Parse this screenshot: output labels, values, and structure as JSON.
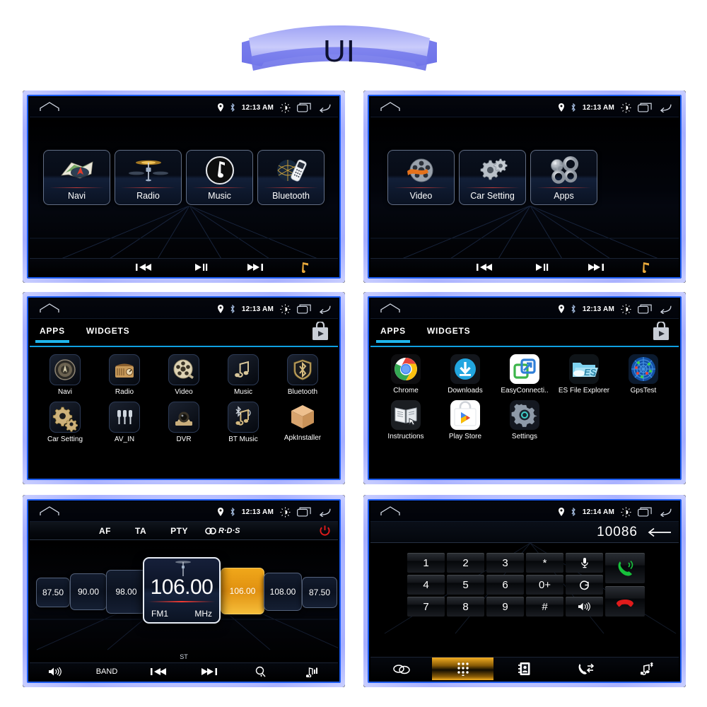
{
  "banner": {
    "title": "UI",
    "color": "#7b7ef0"
  },
  "theme": {
    "accent_blue": "#1b5cf0",
    "tab_underline": "#1fb6ec",
    "highlight_orange": "#f0a71a",
    "call_green": "#17c13b",
    "hangup_red": "#e01b1b"
  },
  "status_bar": {
    "home_icon": "home-icon",
    "location_icon": "location-pin-icon",
    "bluetooth_icon": "bluetooth-icon",
    "time": "12:13 AM",
    "brightness_icon": "brightness-icon",
    "recents_icon": "recents-icon",
    "back_icon": "back-arrow-icon"
  },
  "status_bar_dialer": {
    "time": "12:14 AM"
  },
  "panels": [
    {
      "name": "home-page-1",
      "tiles": [
        {
          "label": "Navi",
          "icon": "map-icon"
        },
        {
          "label": "Radio",
          "icon": "radio-antenna-icon"
        },
        {
          "label": "Music",
          "icon": "music-note-icon"
        },
        {
          "label": "Bluetooth",
          "icon": "bluetooth-phone-icon"
        }
      ],
      "media_bar": [
        "prev-track-icon",
        "play-pause-icon",
        "next-track-icon",
        "music-note-icon"
      ]
    },
    {
      "name": "home-page-2",
      "tiles": [
        {
          "label": "Video",
          "icon": "film-reel-icon"
        },
        {
          "label": "Car Setting",
          "icon": "gears-icon"
        },
        {
          "label": "Apps",
          "icon": "apps-circles-icon"
        }
      ],
      "media_bar": [
        "prev-track-icon",
        "play-pause-icon",
        "next-track-icon",
        "music-note-icon"
      ]
    }
  ],
  "drawer_system": {
    "tabs": [
      {
        "label": "APPS",
        "active": true
      },
      {
        "label": "WIDGETS",
        "active": false
      }
    ],
    "play_store_icon": "play-store-bag-icon",
    "rows": [
      [
        {
          "label": "Navi",
          "icon": "navi-compass-icon"
        },
        {
          "label": "Radio",
          "icon": "retro-radio-icon"
        },
        {
          "label": "Video",
          "icon": "film-reel-icon"
        },
        {
          "label": "Music",
          "icon": "music-note-icon"
        },
        {
          "label": "Bluetooth",
          "icon": "bluetooth-shield-icon"
        }
      ],
      [
        {
          "label": "Car Setting",
          "icon": "gears-icon"
        },
        {
          "label": "AV_IN",
          "icon": "av-jacks-icon"
        },
        {
          "label": "DVR",
          "icon": "dashcam-icon"
        },
        {
          "label": "BT Music",
          "icon": "bt-music-icon"
        },
        {
          "label": "ApkInstaller",
          "icon": "package-box-icon"
        }
      ]
    ]
  },
  "drawer_android": {
    "tabs": [
      {
        "label": "APPS",
        "active": true
      },
      {
        "label": "WIDGETS",
        "active": false
      }
    ],
    "play_store_icon": "play-store-bag-icon",
    "rows": [
      [
        {
          "label": "Chrome",
          "icon": "chrome-icon"
        },
        {
          "label": "Downloads",
          "icon": "download-icon"
        },
        {
          "label": "EasyConnecti..",
          "icon": "easyconnection-icon"
        },
        {
          "label": "ES File Explorer",
          "icon": "es-file-explorer-icon"
        },
        {
          "label": "GpsTest",
          "icon": "gps-radar-icon"
        }
      ],
      [
        {
          "label": "Instructions",
          "icon": "book-icon"
        },
        {
          "label": "Play Store",
          "icon": "play-store-bag-icon"
        },
        {
          "label": "Settings",
          "icon": "settings-gear-icon"
        }
      ]
    ]
  },
  "radio": {
    "top_items": [
      "AF",
      "TA",
      "PTY"
    ],
    "rds_label": "R·D·S",
    "power_icon": "power-icon",
    "presets_left": [
      "87.50",
      "90.00",
      "98.00"
    ],
    "presets_right": [
      "106.00",
      "108.00",
      "87.50"
    ],
    "current": {
      "frequency": "106.00",
      "band": "FM1",
      "unit": "MHz"
    },
    "stereo_label": "ST",
    "bottom_bar": [
      {
        "label": "",
        "icon": "volume-icon"
      },
      {
        "label": "BAND",
        "icon": ""
      },
      {
        "label": "",
        "icon": "prev-track-icon"
      },
      {
        "label": "",
        "icon": "next-track-icon"
      },
      {
        "label": "",
        "icon": "search-scan-icon"
      },
      {
        "label": "",
        "icon": "music-eq-icon"
      }
    ]
  },
  "dialer": {
    "number": "10086",
    "backspace_icon": "backspace-arrow-icon",
    "keys": [
      [
        "1",
        "2",
        "3",
        "*",
        "mic-icon"
      ],
      [
        "4",
        "5",
        "6",
        "0+",
        "refresh-icon"
      ],
      [
        "7",
        "8",
        "9",
        "#",
        "speaker-icon"
      ]
    ],
    "call_icon": "call-green-icon",
    "hangup_icon": "hangup-red-icon",
    "tabs": [
      {
        "icon": "bluetooth-link-icon",
        "active": false
      },
      {
        "icon": "keypad-icon",
        "active": true
      },
      {
        "icon": "contacts-icon",
        "active": false
      },
      {
        "icon": "call-log-icon",
        "active": false
      },
      {
        "icon": "bt-music-note-icon",
        "active": false
      }
    ]
  }
}
